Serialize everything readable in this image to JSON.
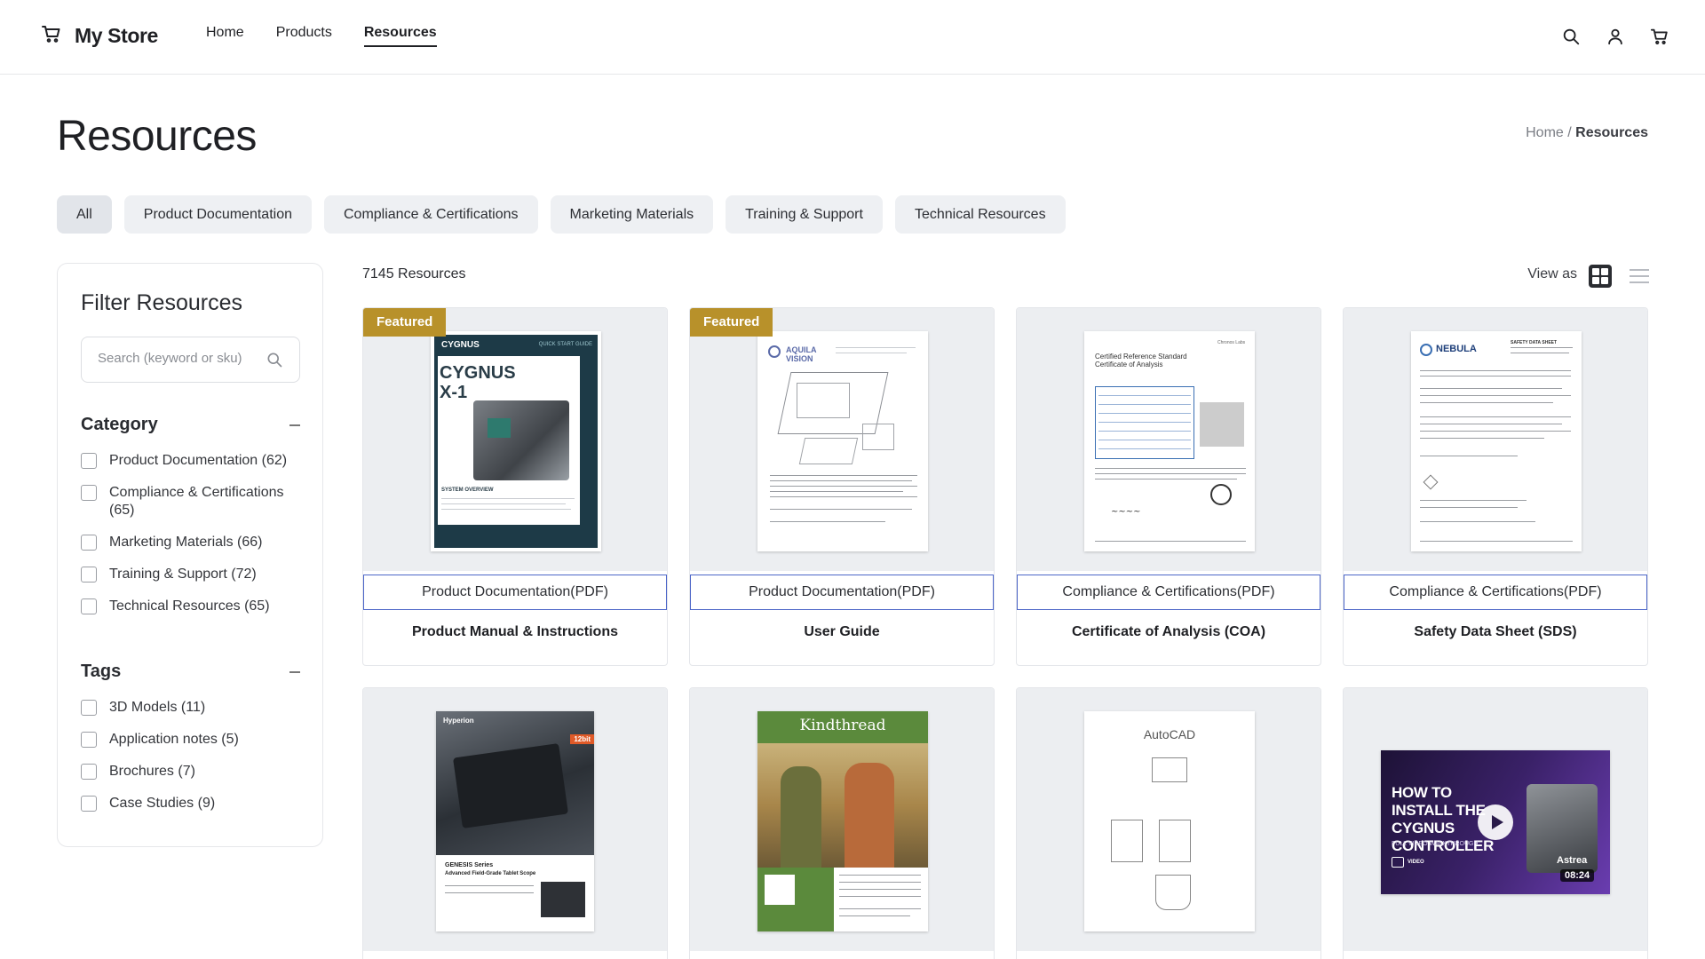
{
  "brand": {
    "name": "My Store"
  },
  "nav": {
    "items": [
      "Home",
      "Products",
      "Resources"
    ],
    "active": "Resources"
  },
  "page": {
    "title": "Resources"
  },
  "breadcrumb": {
    "home": "Home",
    "separator": "/",
    "current": "Resources"
  },
  "tabs": [
    "All",
    "Product Documentation",
    "Compliance & Certifications",
    "Marketing Materials",
    "Training & Support",
    "Technical Resources"
  ],
  "filter": {
    "title": "Filter Resources",
    "search_placeholder": "Search (keyword or sku)",
    "category_label": "Category",
    "categories": [
      "Product Documentation (62)",
      "Compliance & Certifications (65)",
      "Marketing Materials (66)",
      "Training & Support (72)",
      "Technical Resources (65)"
    ],
    "tags_label": "Tags",
    "tags": [
      "3D Models (11)",
      "Application notes (5)",
      "Brochures (7)",
      "Case Studies (9)"
    ]
  },
  "results": {
    "count": "7145 Resources",
    "view_as": "View as",
    "view_mode": "grid"
  },
  "cards": [
    {
      "featured": "Featured",
      "type": "Product Documentation(PDF)",
      "title": "Product Manual & Instructions",
      "thumb_brand": "CYGNUS",
      "thumb_heading": "CYGNUS X-1",
      "thumb_text": "QUICK START GUIDE",
      "thumb_sub": "SYSTEM OVERVIEW"
    },
    {
      "featured": "Featured",
      "type": "Product Documentation(PDF)",
      "title": "User Guide",
      "thumb_brand": "AQUILA VISION"
    },
    {
      "type": "Compliance & Certifications(PDF)",
      "title": "Certificate of Analysis (COA)",
      "thumb_heading": "Certified Reference Standard Certificate of Analysis",
      "thumb_brand": "Chronos Labs"
    },
    {
      "type": "Compliance & Certifications(PDF)",
      "title": "Safety Data Sheet (SDS)",
      "thumb_brand": "NEBULA",
      "thumb_text": "SAFETY DATA SHEET"
    },
    {
      "thumb_brand": "Hyperion",
      "thumb_heading": "GENESIS Series",
      "thumb_sub": "Advanced Field-Grade Tablet Scope",
      "thumb_text": "12bit"
    },
    {
      "thumb_brand": "Kindthread"
    },
    {
      "thumb_heading": "AutoCAD"
    },
    {
      "thumb_heading": "HOW TO INSTALL THE CYGNUS CONTROLLER",
      "thumb_sub": "FULL VIDEO WALKTHROUGH",
      "thumb_brand": "Astrea",
      "thumb_text": "08:24",
      "thumb_label": "VIDEO"
    }
  ],
  "colors": {
    "accent_border": "#4d66c8",
    "badge": "#b8912a",
    "pill_bg": "#eef0f3"
  }
}
